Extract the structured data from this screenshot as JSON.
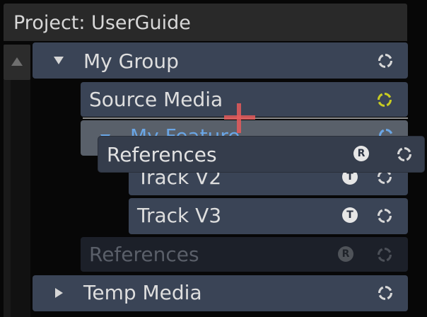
{
  "header": {
    "title": "Project: UserGuide"
  },
  "rows": {
    "my_group": {
      "label": "My Group"
    },
    "source_media": {
      "label": "Source Media"
    },
    "my_feature": {
      "label": "My Feature"
    },
    "track_v2": {
      "label": "Track V2",
      "badge": "T"
    },
    "track_v3": {
      "label": "Track V3",
      "badge": "T"
    },
    "references_original": {
      "label": "References",
      "badge": "R"
    },
    "temp_media": {
      "label": "Temp Media"
    }
  },
  "drag_ghost": {
    "label": "References",
    "badge": "R"
  },
  "icons": {
    "sync_default": "sync-icon",
    "sync_active_color": "#c8cc22",
    "sync_color": "#d8d8d8",
    "sync_dim_color": "#4c5058"
  },
  "colors": {
    "background": "#070707",
    "row": "#3a4456",
    "selected_text": "#6aa6e6",
    "drop_indicator": "#8c8c8c",
    "drag_cursor": "#e65a5a"
  }
}
